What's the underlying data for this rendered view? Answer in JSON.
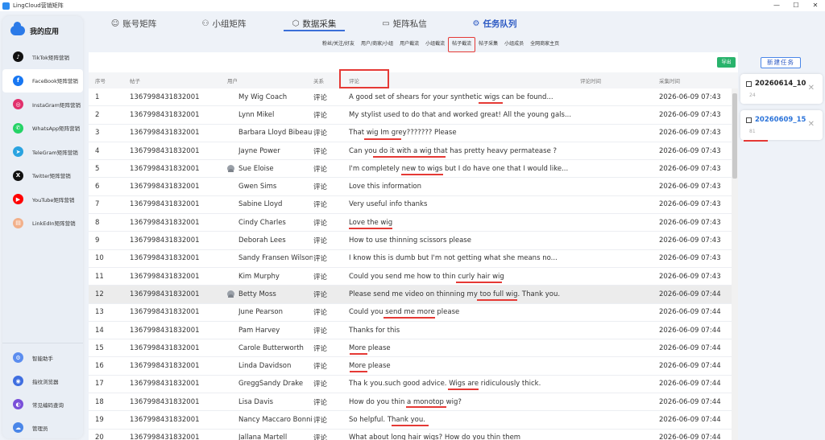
{
  "window": {
    "title": "LingCloud营销矩阵",
    "controls": [
      "—",
      "☐",
      "✕"
    ]
  },
  "sidebar": {
    "header": "我的应用",
    "items": [
      {
        "label": "TikTok矩阵营销",
        "icon": "tiktok-icon",
        "color": "#111111",
        "glyph": "♪"
      },
      {
        "label": "FaceBook矩阵营销",
        "icon": "facebook-icon",
        "color": "#1877f2",
        "glyph": "f"
      },
      {
        "label": "InstaGram矩阵营销",
        "icon": "instagram-icon",
        "color": "#e1306c",
        "glyph": "◎"
      },
      {
        "label": "WhatsApp矩阵营销",
        "icon": "whatsapp-icon",
        "color": "#25d366",
        "glyph": "✆"
      },
      {
        "label": "TeleGram矩阵营销",
        "icon": "telegram-icon",
        "color": "#2aa3e0",
        "glyph": "➤"
      },
      {
        "label": "Twitter矩阵营销",
        "icon": "twitter-x-icon",
        "color": "#111111",
        "glyph": "X"
      },
      {
        "label": "YouTube矩阵营销",
        "icon": "youtube-icon",
        "color": "#ff0000",
        "glyph": "▶"
      },
      {
        "label": "LinkEdIn矩阵营销",
        "icon": "linkedin-icon",
        "color": "#f2b08a",
        "glyph": "▤"
      }
    ],
    "bottom_items": [
      {
        "label": "智能助手",
        "icon": "assistant-icon",
        "color": "#5b8def",
        "glyph": "⚙"
      },
      {
        "label": "指纹浏览器",
        "icon": "browser-icon",
        "color": "#3f6ee0",
        "glyph": "◉"
      },
      {
        "label": "常见编码查询",
        "icon": "code-query-icon",
        "color": "#7a4fd9",
        "glyph": "◐"
      },
      {
        "label": "管理员",
        "icon": "admin-icon",
        "color": "#4a86e8",
        "glyph": "☁"
      }
    ]
  },
  "topnav": {
    "tabs": [
      {
        "label": "账号矩阵",
        "icon": "☺"
      },
      {
        "label": "小组矩阵",
        "icon": "⚇"
      },
      {
        "label": "数据采集",
        "icon": "⬡"
      },
      {
        "label": "矩阵私信",
        "icon": "▭"
      },
      {
        "label": "任务队列",
        "icon": "⚙"
      }
    ]
  },
  "subnav": [
    "粉丝/关注/好友",
    "用户/商家/小组",
    "用户截流",
    "小组截流",
    "帖子截流",
    "帖子采集",
    "小组成员",
    "全网商家主页"
  ],
  "main": {
    "export_label": "导出",
    "columns": {
      "no": "序号",
      "post": "帖子",
      "user": "用户",
      "relation": "关系",
      "comment": "评论",
      "comment_time": "评论时间",
      "collect_time": "采集时间"
    },
    "rows": [
      {
        "no": "1",
        "post": "1367998431832001",
        "user": "My Wig Coach",
        "relation": "评论",
        "comment": "A good set of shears for your synthetic wigs can be found...",
        "time": "2026-06-09 07:43",
        "avatar": false
      },
      {
        "no": "2",
        "post": "1367998431832001",
        "user": "Lynn Mikel",
        "relation": "评论",
        "comment": "My stylist used to do that and worked great! All the young gals...",
        "time": "2026-06-09 07:43",
        "avatar": false
      },
      {
        "no": "3",
        "post": "1367998431832001",
        "user": "Barbara Lloyd Bibeau",
        "relation": "评论",
        "comment": "That wig Im grey??????? Please",
        "time": "2026-06-09 07:43",
        "avatar": false
      },
      {
        "no": "4",
        "post": "1367998431832001",
        "user": "Jayne Power",
        "relation": "评论",
        "comment": "Can you do it with a wig that has pretty heavy permatease ?",
        "time": "2026-06-09 07:43",
        "avatar": false
      },
      {
        "no": "5",
        "post": "1367998431832001",
        "user": "Sue Eloise",
        "relation": "评论",
        "comment": "I'm completely new to wigs but I do have one that I would like...",
        "time": "2026-06-09 07:43",
        "avatar": true
      },
      {
        "no": "6",
        "post": "1367998431832001",
        "user": "Gwen Sims",
        "relation": "评论",
        "comment": "Love this information",
        "time": "2026-06-09 07:43",
        "avatar": false
      },
      {
        "no": "7",
        "post": "1367998431832001",
        "user": "Sabine Lloyd",
        "relation": "评论",
        "comment": "Very useful info thanks",
        "time": "2026-06-09 07:43",
        "avatar": false
      },
      {
        "no": "8",
        "post": "1367998431832001",
        "user": "Cindy Charles",
        "relation": "评论",
        "comment": "Love the wig",
        "time": "2026-06-09 07:43",
        "avatar": false
      },
      {
        "no": "9",
        "post": "1367998431832001",
        "user": "Deborah Lees",
        "relation": "评论",
        "comment": "How to use thinning scissors please",
        "time": "2026-06-09 07:43",
        "avatar": false
      },
      {
        "no": "10",
        "post": "1367998431832001",
        "user": "Sandy Fransen Wilson",
        "relation": "评论",
        "comment": "I know this is dumb  but I'm not getting what she means no...",
        "time": "2026-06-09 07:43",
        "avatar": false
      },
      {
        "no": "11",
        "post": "1367998431832001",
        "user": "Kim Murphy",
        "relation": "评论",
        "comment": "Could you send me how to thin curly hair wig",
        "time": "2026-06-09 07:43",
        "avatar": false
      },
      {
        "no": "12",
        "post": "1367998431832001",
        "user": "Betty Moss",
        "relation": "评论",
        "comment": "Please send me video on thinning my too full wig. Thank you.",
        "time": "2026-06-09 07:44",
        "avatar": true
      },
      {
        "no": "13",
        "post": "1367998431832001",
        "user": "June Pearson",
        "relation": "评论",
        "comment": "Could you send me more please",
        "time": "2026-06-09 07:44",
        "avatar": false
      },
      {
        "no": "14",
        "post": "1367998431832001",
        "user": "Pam Harvey",
        "relation": "评论",
        "comment": "Thanks for this",
        "time": "2026-06-09 07:44",
        "avatar": false
      },
      {
        "no": "15",
        "post": "1367998431832001",
        "user": "Carole Butterworth",
        "relation": "评论",
        "comment": "More please",
        "time": "2026-06-09 07:44",
        "avatar": false
      },
      {
        "no": "16",
        "post": "1367998431832001",
        "user": "Linda Davidson",
        "relation": "评论",
        "comment": "More please",
        "time": "2026-06-09 07:44",
        "avatar": false
      },
      {
        "no": "17",
        "post": "1367998431832001",
        "user": "GreggSandy Drake",
        "relation": "评论",
        "comment": "Tha k you.such  good advice. Wigs are ridiculously thick.",
        "time": "2026-06-09 07:44",
        "avatar": false
      },
      {
        "no": "18",
        "post": "1367998431832001",
        "user": "Lisa Davis",
        "relation": "评论",
        "comment": "How do you thin a monotop wig?",
        "time": "2026-06-09 07:44",
        "avatar": false
      },
      {
        "no": "19",
        "post": "1367998431832001",
        "user": "Nancy Maccaro Bonnin",
        "relation": "评论",
        "comment": "So helpful. Thank you.",
        "time": "2026-06-09 07:44",
        "avatar": false
      },
      {
        "no": "20",
        "post": "1367998431832001",
        "user": "Jallana Martell",
        "relation": "评论",
        "comment": "What about long hair wigs? How do you thin them",
        "time": "2026-06-09 07:44",
        "avatar": false
      }
    ]
  },
  "taskpanel": {
    "new_task_label": "新建任务",
    "tasks": [
      {
        "name": "20260614_10",
        "count": "24"
      },
      {
        "name": "20260609_15",
        "count": "81"
      }
    ]
  },
  "colors": {
    "accent": "#2b59c3",
    "highlight_red": "#e53935",
    "export_green": "#29b36c"
  }
}
